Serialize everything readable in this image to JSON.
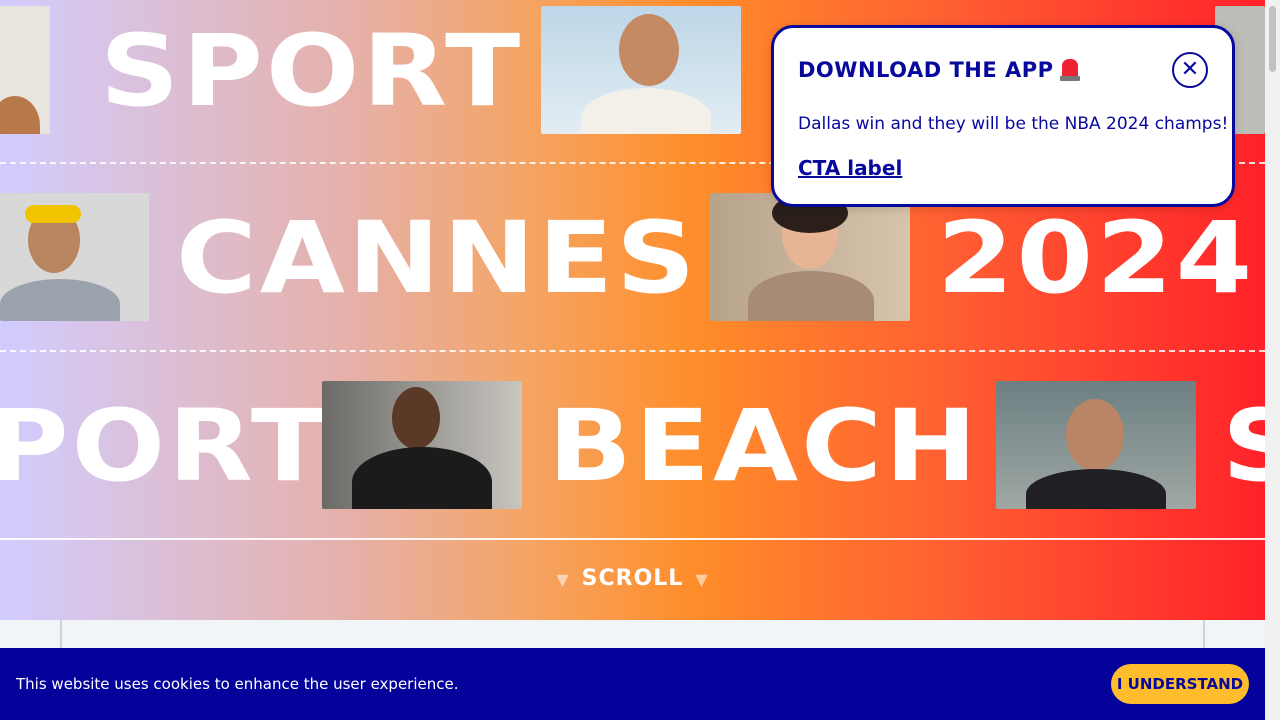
{
  "hero": {
    "row1_words": [
      "SPORT"
    ],
    "row2_words": [
      "CANNES",
      "2024"
    ],
    "row3_words": [
      "PORT",
      "BEACH",
      "S"
    ],
    "scroll_label": "SCROLL",
    "scroll_arrow": "▼"
  },
  "popup": {
    "title": "DOWNLOAD THE APP",
    "title_icon": "siren-icon",
    "close_icon": "close-icon",
    "close_glyph": "✕",
    "message": "Dallas win and they will be the NBA 2024 champs!",
    "cta_label": "CTA label"
  },
  "cookie_banner": {
    "text": "This website uses cookies to enhance the user experience.",
    "button_label": "I UNDERSTAND"
  },
  "colors": {
    "brand_blue": "#07089c",
    "cookie_bg": "#04029b",
    "button_yellow": "#ffbd2e",
    "gradient_start": "#d2ccff",
    "gradient_mid": "#ff8d2a",
    "gradient_end": "#ff2229"
  }
}
